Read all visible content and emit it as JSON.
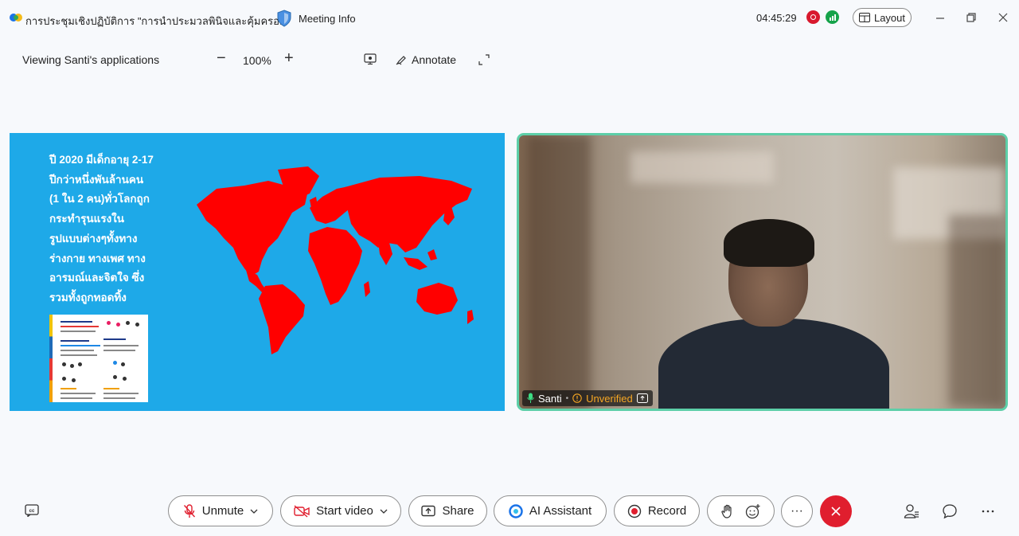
{
  "titlebar": {
    "meeting_title": "การประชุมเชิงปฏิบัติการ \"การนำประมวลพินิจและคุ้มครอ...",
    "info_label": "Meeting Info",
    "timer": "04:45:29",
    "layout_label": "Layout"
  },
  "toolbar": {
    "viewing": "Viewing Santi's applications",
    "zoom_minus": "−",
    "zoom_level": "100%",
    "zoom_plus": "+",
    "annotate": "Annotate"
  },
  "slide": {
    "lines": [
      "ปี 2020 มีเด็กอายุ 2-17",
      "ปีกว่าหนึ่งพันล้านคน",
      "(1 ใน 2 คน)ทั่วโลกถูก",
      "กระทำรุนแรงใน",
      "รูปแบบต่างๆทั้งทาง",
      "ร่างกาย ทางเพศ ทาง",
      "อารมณ์และจิตใจ ซึ่ง",
      "รวมทั้งถูกทอดทิ้ง"
    ],
    "background": "#1ea9e8",
    "map_color": "#ff0000"
  },
  "video": {
    "name": "Santi",
    "status": "Unverified"
  },
  "controls": {
    "unmute": "Unmute",
    "start_video": "Start video",
    "share": "Share",
    "ai_assistant": "AI Assistant",
    "record": "Record",
    "more": "···"
  },
  "colors": {
    "accent": "#1a73e8",
    "end_call": "#e01e2e",
    "tile_border": "#5dcfa8"
  }
}
